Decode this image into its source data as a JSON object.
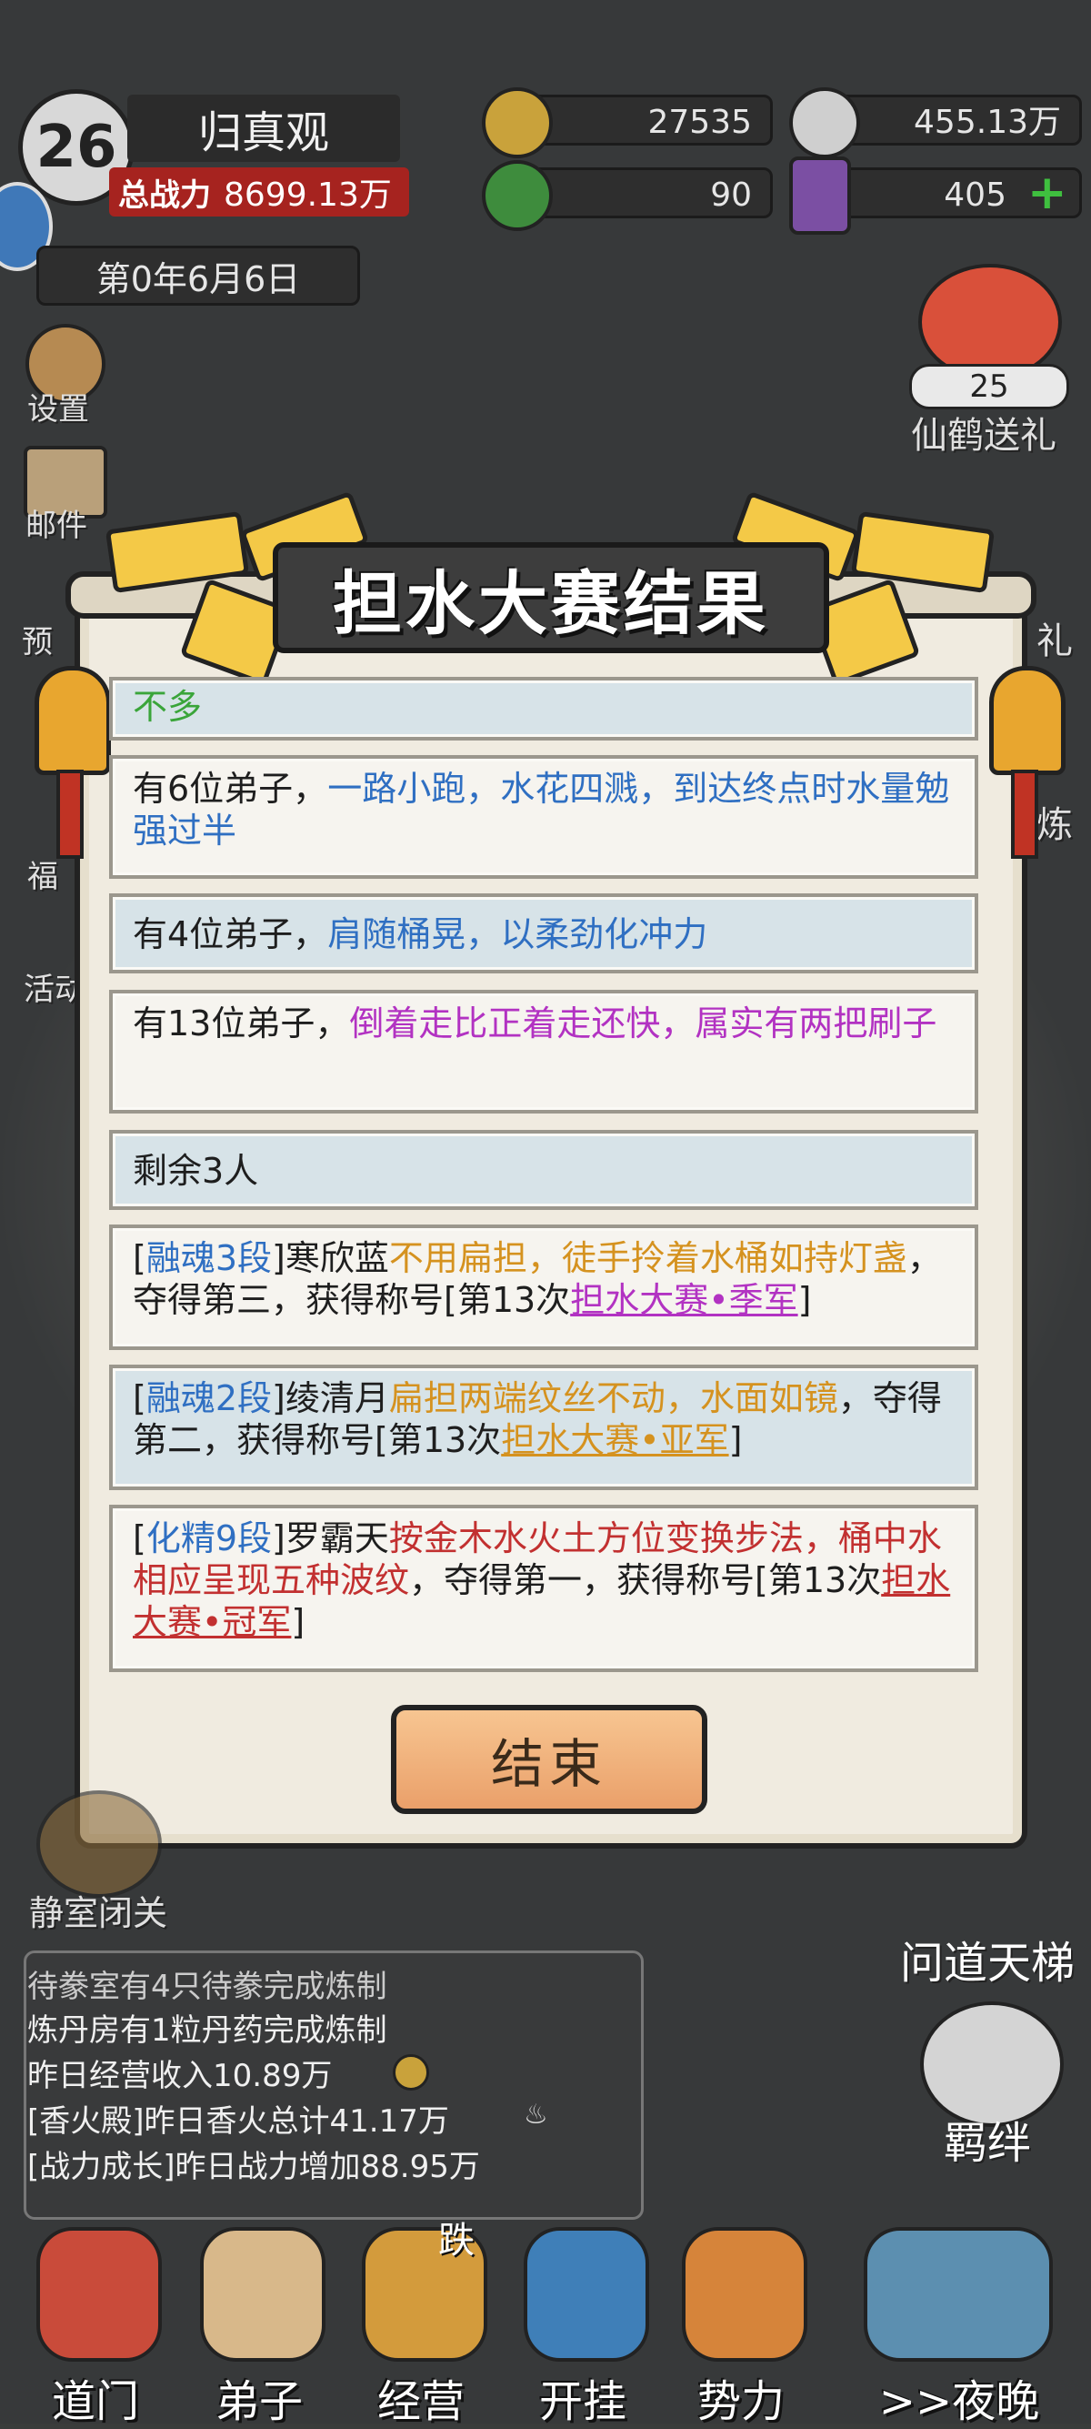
{
  "header": {
    "level": "26",
    "sect_name": "归真观",
    "power_label": "总战力",
    "power_value": "8699.13万",
    "date": "第0年6月6日",
    "coins": "27535",
    "incense": "455.13万",
    "spirit": "90",
    "tokens": "405"
  },
  "left_menu": [
    "设置",
    "邮件",
    "预",
    "福",
    "活动"
  ],
  "right_menu": {
    "crane_count": "25",
    "crane_label": "仙鹤送礼",
    "gift_partial": "礼",
    "refine_partial": "炼"
  },
  "dialog": {
    "title": "担水大赛结果",
    "entries": [
      {
        "parts": [
          {
            "t": "不多",
            "c": "c-green"
          }
        ]
      },
      {
        "parts": [
          {
            "t": "有6位弟子，",
            "c": ""
          },
          {
            "t": "一路小跑，水花四溅，到达终点时水量勉强过半",
            "c": "c-blue"
          }
        ]
      },
      {
        "parts": [
          {
            "t": "有4位弟子，",
            "c": ""
          },
          {
            "t": "肩随桶晃，以柔劲化冲力",
            "c": "c-blue"
          }
        ]
      },
      {
        "parts": [
          {
            "t": "有13位弟子，",
            "c": ""
          },
          {
            "t": "倒着走比正着走还快，属实有两把刷子",
            "c": "c-purple"
          }
        ]
      },
      {
        "parts": [
          {
            "t": "剩余3人",
            "c": ""
          }
        ]
      },
      {
        "parts": [
          {
            "t": "[",
            "c": ""
          },
          {
            "t": "融魂3段",
            "c": "c-blue"
          },
          {
            "t": "]寒欣蓝",
            "c": ""
          },
          {
            "t": "不用扁担，徒手拎着水桶如持灯盏",
            "c": "c-gold"
          },
          {
            "t": "，夺得第三，获得称号[第13次",
            "c": ""
          },
          {
            "t": "担水大赛•季军",
            "c": "c-purple ul"
          },
          {
            "t": "]",
            "c": ""
          }
        ]
      },
      {
        "parts": [
          {
            "t": "[",
            "c": ""
          },
          {
            "t": "融魂2段",
            "c": "c-blue"
          },
          {
            "t": "]绫清月",
            "c": ""
          },
          {
            "t": "扁担两端纹丝不动，水面如镜",
            "c": "c-gold"
          },
          {
            "t": "，夺得第二，获得称号[第13次",
            "c": ""
          },
          {
            "t": "担水大赛•亚军",
            "c": "c-gold ul"
          },
          {
            "t": "]",
            "c": ""
          }
        ]
      },
      {
        "parts": [
          {
            "t": "[",
            "c": ""
          },
          {
            "t": "化精9段",
            "c": "c-blue"
          },
          {
            "t": "]罗霸天",
            "c": ""
          },
          {
            "t": "按金木水火土方位变换步法，桶中水相应呈现五种波纹",
            "c": "c-red"
          },
          {
            "t": "，夺得第一，获得称号[第13次",
            "c": ""
          },
          {
            "t": "担水大赛•冠军",
            "c": "c-red ul"
          },
          {
            "t": "]",
            "c": ""
          }
        ]
      }
    ],
    "end_button": "结束"
  },
  "left_bottom": "静室闭关",
  "right_bottom": [
    "问道天梯",
    "羁绊"
  ],
  "log": {
    "lines": [
      {
        "t": "待豢室有4只待豢完成炼制",
        "c": ""
      },
      {
        "t": "炼丹房有1粒丹药完成炼制",
        "c": ""
      },
      {
        "t": "昨日经营收入10.89万",
        "c": "c-red"
      },
      {
        "t": "[香火殿]昨日香火总计41.17万",
        "c": "c-red"
      },
      {
        "t": "[战力成长]昨日战力增加88.95万",
        "c": "c-green"
      }
    ]
  },
  "nav": [
    {
      "label": "道门",
      "color": "#c94b3a"
    },
    {
      "label": "弟子",
      "color": "#d8b88a"
    },
    {
      "label": "经营",
      "badge": "跌",
      "color": "#d39b3c"
    },
    {
      "label": "开挂",
      "color": "#3f7fb8"
    },
    {
      "label": "势力",
      "color": "#d6843a"
    },
    {
      "label": ">>夜晚",
      "color": "#5c8fb0"
    }
  ]
}
